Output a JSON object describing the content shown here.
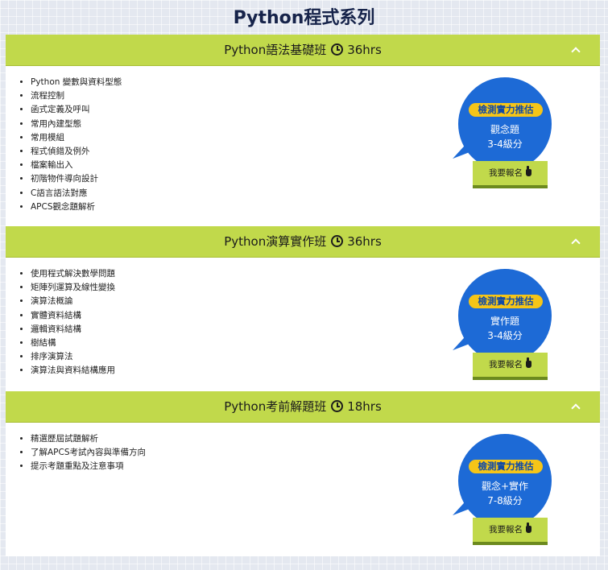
{
  "page": {
    "title": "Python程式系列"
  },
  "icons": {
    "collapse": "chevron-up-icon",
    "clock": "clock-icon",
    "pointer": "hand-pointer-icon"
  },
  "colors": {
    "header_green": "#c1d94b",
    "badge_blue": "#1d6ad6",
    "badge_yellow": "#f5c518",
    "title_navy": "#16234a"
  },
  "sections": [
    {
      "title": "Python語法基礎班",
      "hours": "36hrs",
      "topics": [
        "Python 變數與資料型態",
        "流程控制",
        "函式定義及呼叫",
        "常用內建型態",
        "常用模組",
        "程式偵錯及例外",
        "檔案輸出入",
        "初階物件導向設計",
        "C語言語法對應",
        "APCS觀念題解析"
      ],
      "badge": {
        "tag": "檢測實力推估",
        "line1": "觀念題",
        "line2": "3-4級分",
        "button": "我要報名"
      }
    },
    {
      "title": "Python演算實作班",
      "hours": "36hrs",
      "topics": [
        "使用程式解決數學問題",
        "矩陣列運算及線性變換",
        "演算法概論",
        "實體資料結構",
        "邏輯資料結構",
        "樹結構",
        "排序演算法",
        "演算法與資料結構應用"
      ],
      "badge": {
        "tag": "檢測實力推估",
        "line1": "實作題",
        "line2": "3-4級分",
        "button": "我要報名"
      }
    },
    {
      "title": "Python考前解題班",
      "hours": "18hrs",
      "topics": [
        "精選歷屆試題解析",
        "了解APCS考試內容與準備方向",
        "提示考題重點及注意事項"
      ],
      "badge": {
        "tag": "檢測實力推估",
        "line1": "觀念+實作",
        "line2": "7-8級分",
        "button": "我要報名"
      }
    }
  ]
}
